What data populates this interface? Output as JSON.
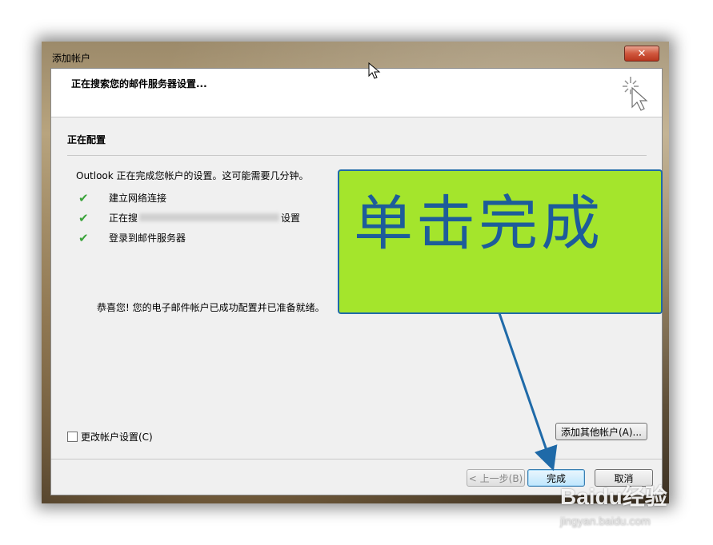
{
  "window": {
    "title": "添加帐户",
    "close_glyph": "✕"
  },
  "header": {
    "title": "正在搜索您的邮件服务器设置..."
  },
  "section": {
    "title": "正在配置"
  },
  "info": {
    "text": "Outlook 正在完成您帐户的设置。这可能需要几分钟。"
  },
  "steps": [
    {
      "label": "建立网络连接"
    },
    {
      "label_prefix": "正在搜",
      "label_suffix": "设置"
    },
    {
      "label": "登录到邮件服务器"
    }
  ],
  "congrats": "恭喜您! 您的电子邮件帐户已成功配置并已准备就绪。",
  "change_settings": {
    "label": "更改帐户设置(C)",
    "checked": false
  },
  "buttons": {
    "add_other": "添加其他帐户(A)...",
    "back": "< 上一步(B)",
    "finish": "完成",
    "cancel": "取消"
  },
  "annotation": {
    "text": "单击完成",
    "bg_color": "#a4e52c",
    "text_color": "#1d5c9a"
  },
  "watermark": {
    "main": "Baidu经验",
    "sub": "jingyan.baidu.com"
  },
  "colors": {
    "check": "#3aa33a",
    "close_button": "#c94a30",
    "arrow": "#1f6aa8"
  }
}
